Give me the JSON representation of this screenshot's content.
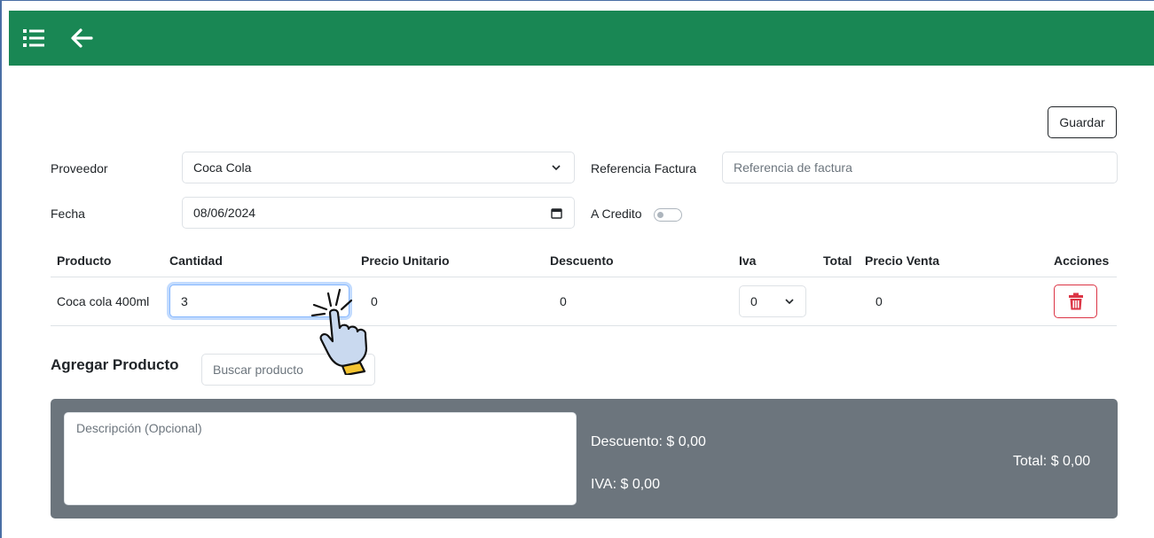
{
  "topbar": {
    "color": "#198754",
    "menu_icon": "list-icon",
    "back_icon": "arrow-left-icon"
  },
  "actions": {
    "save_label": "Guardar"
  },
  "form": {
    "proveedor_label": "Proveedor",
    "proveedor_value": "Coca Cola",
    "referencia_label": "Referencia Factura",
    "referencia_placeholder": "Referencia de factura",
    "fecha_label": "Fecha",
    "fecha_value": "08/06/2024",
    "credito_label": "A Credito",
    "credito_checked": false
  },
  "table": {
    "headers": {
      "producto": "Producto",
      "cantidad": "Cantidad",
      "precio_unitario": "Precio Unitario",
      "descuento": "Descuento",
      "iva": "Iva",
      "total": "Total",
      "precio_venta": "Precio Venta",
      "acciones": "Acciones"
    },
    "rows": [
      {
        "producto": "Coca cola 400ml",
        "cantidad": "3",
        "precio_unitario": "0",
        "descuento": "0",
        "iva": "0",
        "precio_venta": "0"
      }
    ]
  },
  "add_product": {
    "label": "Agregar Producto",
    "search_placeholder": "Buscar producto"
  },
  "summary": {
    "background": "#6c757d",
    "description_placeholder": "Descripción (Opcional)",
    "descuento": "Descuento: $ 0,00",
    "iva": "IVA: $ 0,00",
    "total": "Total: $ 0,00"
  },
  "accent_colors": {
    "danger": "#dc3545",
    "focus": "#86b7fe"
  }
}
